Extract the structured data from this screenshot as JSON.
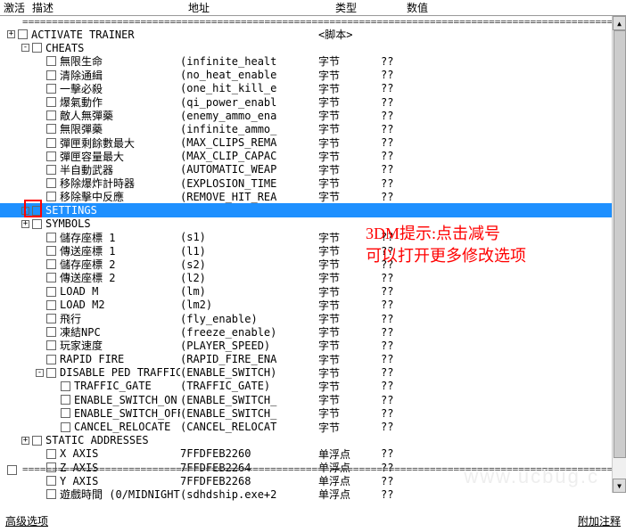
{
  "header": {
    "c1": "激活",
    "c2": "描述",
    "c3": "地址",
    "c4": "类型",
    "c5": "数值"
  },
  "hint_line1": "3DM提示:点击减号",
  "hint_line2": "可以打开更多修改选项",
  "footer_left": "高级选项",
  "footer_right": "附加注释",
  "plus": "+",
  "minus": "-",
  "divider_text": "==============================================================================================================",
  "tree": [
    {
      "level": 0,
      "toggle": "+",
      "check": true,
      "desc": "ACTIVATE TRAINER",
      "addr": "",
      "type": "<脚本>",
      "val": "",
      "name": "activate-trainer"
    },
    {
      "level": 1,
      "toggle": "-",
      "check": true,
      "desc": "CHEATS",
      "addr": "",
      "type": "",
      "val": "",
      "name": "cheats-group"
    },
    {
      "level": 2,
      "toggle": "",
      "check": true,
      "desc": "無限生命",
      "addr": "(infinite_healt",
      "type": "字节",
      "val": "??",
      "name": "infinite-health"
    },
    {
      "level": 2,
      "toggle": "",
      "check": true,
      "desc": "清除通緝",
      "addr": "(no_heat_enable",
      "type": "字节",
      "val": "??",
      "name": "no-heat"
    },
    {
      "level": 2,
      "toggle": "",
      "check": true,
      "desc": "一擊必殺",
      "addr": "(one_hit_kill_e",
      "type": "字节",
      "val": "??",
      "name": "one-hit-kill"
    },
    {
      "level": 2,
      "toggle": "",
      "check": true,
      "desc": "爆氣動作",
      "addr": "(qi_power_enabl",
      "type": "字节",
      "val": "??",
      "name": "qi-power"
    },
    {
      "level": 2,
      "toggle": "",
      "check": true,
      "desc": "敵人無彈藥",
      "addr": "(enemy_ammo_ena",
      "type": "字节",
      "val": "??",
      "name": "enemy-ammo"
    },
    {
      "level": 2,
      "toggle": "",
      "check": true,
      "desc": "無限彈藥",
      "addr": "(infinite_ammo_",
      "type": "字节",
      "val": "??",
      "name": "infinite-ammo"
    },
    {
      "level": 2,
      "toggle": "",
      "check": true,
      "desc": "彈匣剩餘數最大",
      "addr": "(MAX_CLIPS_REMA",
      "type": "字节",
      "val": "??",
      "name": "max-clips"
    },
    {
      "level": 2,
      "toggle": "",
      "check": true,
      "desc": "彈匣容量最大",
      "addr": "(MAX_CLIP_CAPAC",
      "type": "字节",
      "val": "??",
      "name": "max-clip-cap"
    },
    {
      "level": 2,
      "toggle": "",
      "check": true,
      "desc": "半自動武器",
      "addr": "(AUTOMATIC_WEAP",
      "type": "字节",
      "val": "??",
      "name": "auto-weapon"
    },
    {
      "level": 2,
      "toggle": "",
      "check": true,
      "desc": "移除爆炸計時器",
      "addr": "(EXPLOSION_TIME",
      "type": "字节",
      "val": "??",
      "name": "explosion-time"
    },
    {
      "level": 2,
      "toggle": "",
      "check": true,
      "desc": "移除擊中反應",
      "addr": "(REMOVE_HIT_REA",
      "type": "字节",
      "val": "??",
      "name": "remove-hit"
    },
    {
      "level": 1,
      "toggle": "-",
      "check": true,
      "desc": "SETTINGS",
      "addr": "",
      "type": "",
      "val": "",
      "name": "settings-group",
      "selected": true
    },
    {
      "level": 1,
      "toggle": "+",
      "check": true,
      "desc": "SYMBOLS",
      "addr": "",
      "type": "",
      "val": "",
      "name": "symbols-group"
    },
    {
      "level": 2,
      "toggle": "",
      "check": true,
      "desc": "儲存座標 1",
      "addr": "(s1)",
      "type": "字节",
      "val": "??",
      "name": "save-coord-1"
    },
    {
      "level": 2,
      "toggle": "",
      "check": true,
      "desc": "傳送座標 1",
      "addr": "(l1)",
      "type": "字节",
      "val": "??",
      "name": "load-coord-1"
    },
    {
      "level": 2,
      "toggle": "",
      "check": true,
      "desc": "儲存座標 2",
      "addr": "(s2)",
      "type": "字节",
      "val": "??",
      "name": "save-coord-2"
    },
    {
      "level": 2,
      "toggle": "",
      "check": true,
      "desc": "傳送座標 2",
      "addr": "(l2)",
      "type": "字节",
      "val": "??",
      "name": "load-coord-2"
    },
    {
      "level": 2,
      "toggle": "",
      "check": true,
      "desc": "LOAD M",
      "addr": "(lm)",
      "type": "字节",
      "val": "??",
      "name": "load-m"
    },
    {
      "level": 2,
      "toggle": "",
      "check": true,
      "desc": "LOAD M2",
      "addr": "(lm2)",
      "type": "字节",
      "val": "??",
      "name": "load-m2"
    },
    {
      "level": 2,
      "toggle": "",
      "check": true,
      "desc": "飛行",
      "addr": "(fly_enable)",
      "type": "字节",
      "val": "??",
      "name": "fly"
    },
    {
      "level": 2,
      "toggle": "",
      "check": true,
      "desc": "凍結NPC",
      "addr": "(freeze_enable)",
      "type": "字节",
      "val": "??",
      "name": "freeze-npc"
    },
    {
      "level": 2,
      "toggle": "",
      "check": true,
      "desc": "玩家速度",
      "addr": "(PLAYER_SPEED)",
      "type": "字节",
      "val": "??",
      "name": "player-speed"
    },
    {
      "level": 2,
      "toggle": "",
      "check": true,
      "desc": "RAPID FIRE",
      "addr": "(RAPID_FIRE_ENA",
      "type": "字节",
      "val": "??",
      "name": "rapid-fire"
    },
    {
      "level": 2,
      "toggle": "-",
      "check": true,
      "desc": "DISABLE PED TRAFFIC",
      "addr": "(ENABLE_SWITCH)",
      "type": "字节",
      "val": "??",
      "name": "disable-ped"
    },
    {
      "level": 3,
      "toggle": "",
      "check": true,
      "desc": "TRAFFIC_GATE",
      "addr": "(TRAFFIC_GATE)",
      "type": "字节",
      "val": "??",
      "name": "traffic-gate"
    },
    {
      "level": 3,
      "toggle": "",
      "check": true,
      "desc": "ENABLE_SWITCH_ON",
      "addr": "(ENABLE_SWITCH_",
      "type": "字节",
      "val": "??",
      "name": "enable-switch-on"
    },
    {
      "level": 3,
      "toggle": "",
      "check": true,
      "desc": "ENABLE_SWITCH_OFF",
      "addr": "(ENABLE_SWITCH_",
      "type": "字节",
      "val": "??",
      "name": "enable-switch-off"
    },
    {
      "level": 3,
      "toggle": "",
      "check": true,
      "desc": "CANCEL_RELOCATE",
      "addr": "(CANCEL_RELOCAT",
      "type": "字节",
      "val": "??",
      "name": "cancel-relocate"
    },
    {
      "level": 1,
      "toggle": "+",
      "check": true,
      "desc": "STATIC ADDRESSES",
      "addr": "",
      "type": "",
      "val": "",
      "name": "static-addr"
    },
    {
      "level": 2,
      "toggle": "",
      "check": true,
      "desc": "X AXIS",
      "addr": "7FFDFEB2260",
      "type": "单浮点",
      "val": "??",
      "name": "x-axis"
    },
    {
      "level": 2,
      "toggle": "",
      "check": true,
      "desc": "Z AXIS",
      "addr": "7FFDFEB2264",
      "type": "单浮点",
      "val": "??",
      "name": "z-axis"
    },
    {
      "level": 2,
      "toggle": "",
      "check": true,
      "desc": "Y AXIS",
      "addr": "7FFDFEB2268",
      "type": "单浮点",
      "val": "??",
      "name": "y-axis"
    },
    {
      "level": 2,
      "toggle": "",
      "check": true,
      "desc": "遊戲時間 (0/MIDNIGHT",
      "addr": "(sdhdship.exe+2",
      "type": "单浮点",
      "val": "??",
      "name": "game-time"
    }
  ]
}
